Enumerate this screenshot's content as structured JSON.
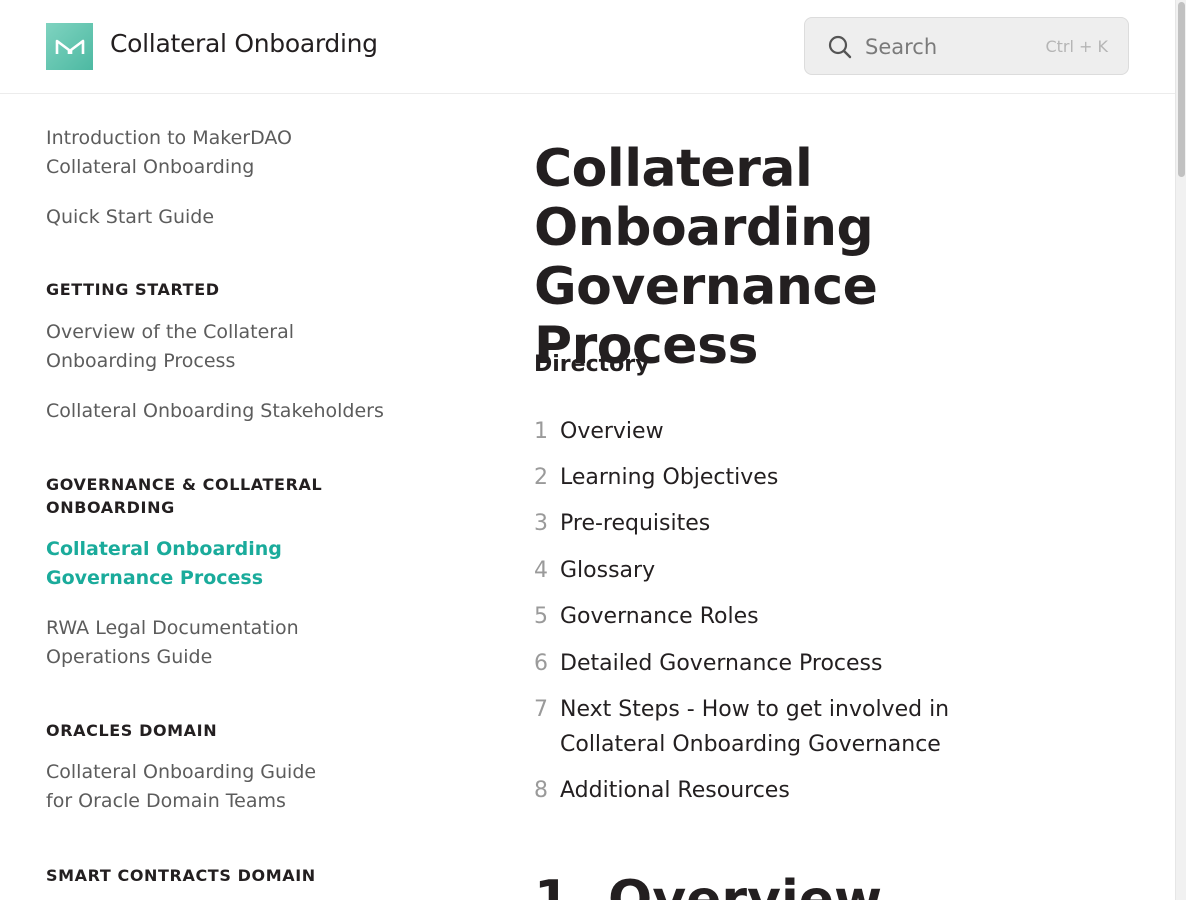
{
  "header": {
    "site_title": "Collateral Onboarding",
    "search_placeholder": "Search",
    "search_shortcut": "Ctrl + K"
  },
  "sidebar": {
    "top_links": [
      "Introduction to MakerDAO Collateral Onboarding",
      "Quick Start Guide"
    ],
    "sections": [
      {
        "title": "GETTING STARTED",
        "links": [
          "Overview of the Collateral Onboarding Process",
          "Collateral Onboarding Stakeholders"
        ]
      },
      {
        "title": "GOVERNANCE & COLLATERAL ONBOARDING",
        "links": [
          "Collateral Onboarding Governance Process",
          "RWA Legal Documentation Operations Guide"
        ],
        "active_link": "Collateral Onboarding Governance Process"
      },
      {
        "title": "ORACLES DOMAIN",
        "links": [
          "Collateral Onboarding Guide for Oracle Domain Teams"
        ]
      },
      {
        "title": "SMART CONTRACTS DOMAIN",
        "links": []
      }
    ]
  },
  "main": {
    "title": "Collateral Onboarding Governance Process",
    "directory_heading": "Directory",
    "toc": [
      {
        "num": "1",
        "label": "Overview"
      },
      {
        "num": "2",
        "label": "Learning Objectives"
      },
      {
        "num": "3",
        "label": "Pre-requisites"
      },
      {
        "num": "4",
        "label": "Glossary"
      },
      {
        "num": "5",
        "label": "Governance Roles"
      },
      {
        "num": "6",
        "label": "Detailed Governance Process"
      },
      {
        "num": "7",
        "label": "Next Steps - How to get involved in Collateral Onboarding Governance"
      },
      {
        "num": "8",
        "label": "Additional Resources"
      }
    ],
    "next_section_heading": "1. Overview"
  },
  "colors": {
    "accent": "#1aab9b",
    "text": "#231f20",
    "muted": "#5c5c5c"
  }
}
